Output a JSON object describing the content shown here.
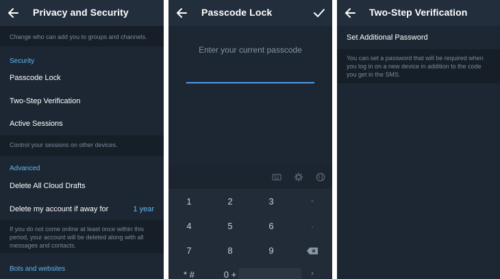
{
  "privacy": {
    "title": "Privacy and Security",
    "groups_hint": "Change who can add you to groups and channels.",
    "security_header": "Security",
    "passcode_lock": "Passcode Lock",
    "two_step": "Two-Step Verification",
    "active_sessions": "Active Sessions",
    "sessions_hint": "Control your sessions on other devices.",
    "advanced_header": "Advanced",
    "delete_drafts": "Delete All Cloud Drafts",
    "delete_account": "Delete my account if away for",
    "delete_account_value": "1 year",
    "delete_hint": "If you do not come online at least once within this period, your account will be deleted along with all messages and contacts.",
    "bots_header": "Bots and websites"
  },
  "passcode": {
    "title": "Passcode Lock",
    "prompt": "Enter your current passcode",
    "keys": [
      "1",
      "2",
      "3",
      "-",
      "4",
      "5",
      "6",
      ".",
      "7",
      "8",
      "9"
    ],
    "key_star_hash": "* #",
    "key_zero_plus": "0 +",
    "key_next": "›"
  },
  "twostep": {
    "title": "Two-Step Verification",
    "set_password": "Set Additional Password",
    "password_hint": "You can set a password that will be required when you log in on a new device in addition to the code you get in the SMS."
  },
  "colors": {
    "background": "#1d2733",
    "header": "#232e3c",
    "hint_bg": "#161e28",
    "accent": "#64b5ef"
  },
  "icons": [
    "back-arrow-icon",
    "checkmark-icon",
    "keyboard-icon",
    "gear-icon",
    "globe-icon",
    "backspace-icon"
  ]
}
